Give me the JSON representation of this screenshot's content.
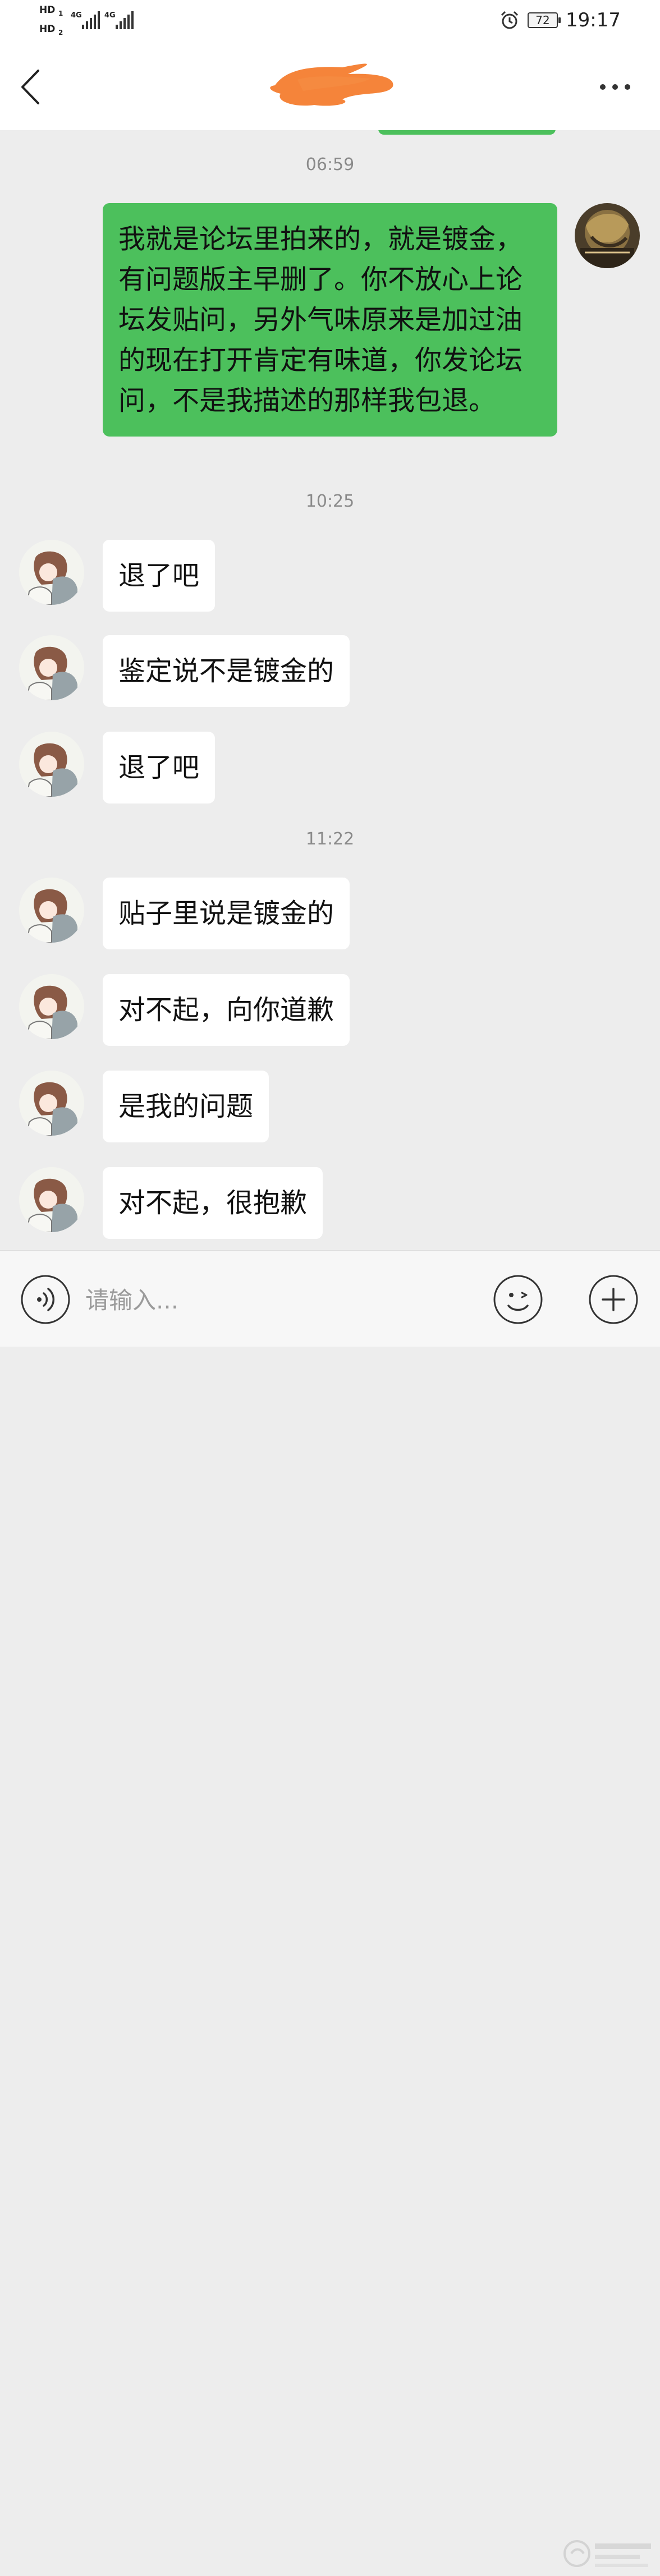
{
  "status_bar": {
    "sim1": "HD",
    "sim1_slot": "1",
    "sim2": "HD",
    "sim2_slot": "2",
    "network1": "4G",
    "network2": "4G",
    "alarm_icon": "alarm-clock-icon",
    "battery": "72",
    "time": "19:17"
  },
  "nav": {
    "back_icon": "chevron-left-icon",
    "title_redaction_color": "#f5843a",
    "more_icon": "more-dots-icon"
  },
  "colors": {
    "outgoing_bubble": "#4cc05c",
    "incoming_bubble": "#ffffff",
    "chat_background": "#ededed"
  },
  "chat": {
    "timestamps": [
      "06:59",
      "10:25",
      "11:22"
    ],
    "outgoing": [
      {
        "text": "我就是论坛里拍来的，就是镀金，有问题版主早删了。你不放心上论坛发贴问，另外气味原来是加过油的现在打开肯定有味道，你发论坛问，不是我描述的那样我包退。"
      }
    ],
    "incoming": [
      {
        "text": "退了吧"
      },
      {
        "text": "鉴定说不是镀金的"
      },
      {
        "text": "退了吧"
      },
      {
        "text": "贴子里说是镀金的"
      },
      {
        "text": "对不起，向你道歉"
      },
      {
        "text": "是我的问题"
      },
      {
        "text": "对不起，很抱歉"
      }
    ]
  },
  "input_bar": {
    "voice_icon": "voice-icon",
    "placeholder": "请输入...",
    "emoji_icon": "emoji-icon",
    "plus_icon": "plus-icon"
  }
}
